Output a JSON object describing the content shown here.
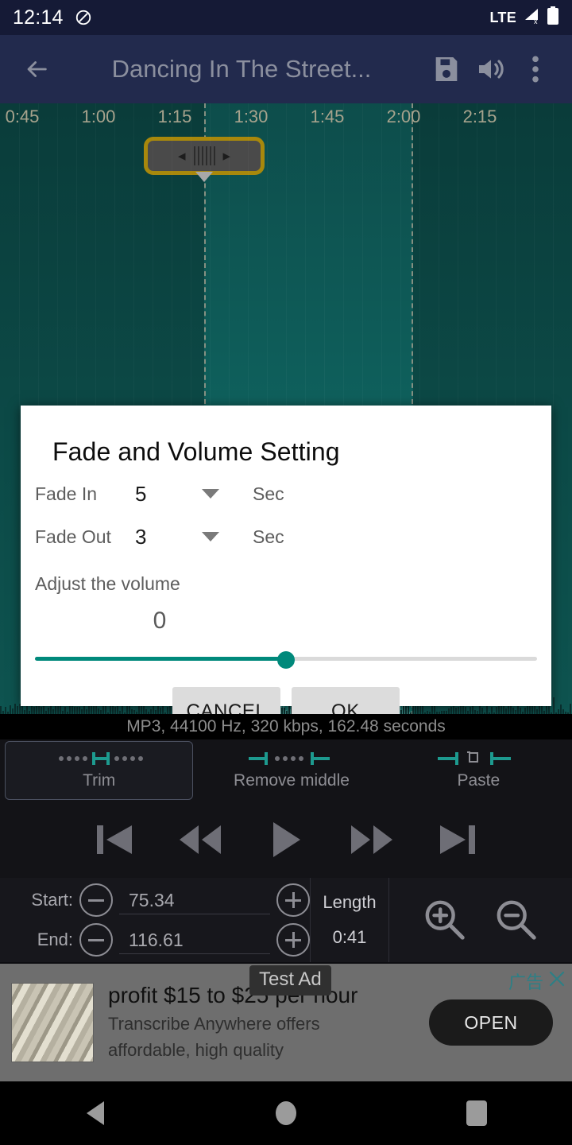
{
  "status_bar": {
    "clock": "12:14",
    "dnd_icon": "do-not-disturb-icon",
    "network_label": "LTE",
    "signal_icon": "signal-no-service-icon",
    "battery_icon": "battery-full-icon"
  },
  "app_bar": {
    "back_icon": "back-arrow-icon",
    "title": "Dancing In The Street...",
    "save_icon": "save-icon",
    "volume_icon": "volume-icon",
    "overflow_icon": "more-vertical-icon"
  },
  "waveform": {
    "ruler_ticks": [
      "0:45",
      "1:00",
      "1:15",
      "1:30",
      "1:45",
      "2:00",
      "2:15"
    ],
    "handle_left_arrow": "◂",
    "handle_right_arrow": "▸",
    "selection_start_label": "1:15",
    "selection_end_label": "2:00",
    "selection_color": "#12706b",
    "background_color": "#0c4a47",
    "handle_border_color": "#a8880c"
  },
  "dialog": {
    "title": "Fade and Volume Setting",
    "fade_in": {
      "label": "Fade In",
      "value": "5",
      "unit": "Sec",
      "caret_icon": "chevron-down-icon"
    },
    "fade_out": {
      "label": "Fade Out",
      "value": "3",
      "unit": "Sec",
      "caret_icon": "chevron-down-icon"
    },
    "volume_section_label": "Adjust the volume",
    "volume_value": "0",
    "volume_percent": 50,
    "accent_color": "#00897b",
    "cancel_label": "CANCEL",
    "ok_label": "OK"
  },
  "file_info": "MP3, 44100 Hz, 320 kbps, 162.48 seconds",
  "edit_modes": [
    {
      "label": "Trim",
      "icon": "trim-icon",
      "selected": true
    },
    {
      "label": "Remove middle",
      "icon": "remove-middle-icon",
      "selected": false
    },
    {
      "label": "Paste",
      "icon": "paste-icon",
      "selected": false
    }
  ],
  "transport": [
    {
      "name": "skip-to-start-icon"
    },
    {
      "name": "rewind-icon"
    },
    {
      "name": "play-icon"
    },
    {
      "name": "fast-forward-icon"
    },
    {
      "name": "skip-to-end-icon"
    }
  ],
  "selection_panel": {
    "start_label": "Start:",
    "start_value": "75.34",
    "end_label": "End:",
    "end_value": "116.61",
    "length_label": "Length",
    "length_value": "0:41",
    "minus_icon": "minus-circle-icon",
    "plus_icon": "plus-circle-icon",
    "zoom_in_icon": "zoom-in-icon",
    "zoom_out_icon": "zoom-out-icon"
  },
  "ad": {
    "badge": "Test Ad",
    "flag_label": "广告",
    "close_icon": "close-icon",
    "headline": "profit $15 to $25 per hour",
    "body_line1": "Transcribe Anywhere offers",
    "body_line2": "affordable, high quality",
    "cta_label": "OPEN",
    "thumbnail_icon": "money-image"
  },
  "nav_bar": {
    "back_icon": "nav-back-icon",
    "home_icon": "nav-home-icon",
    "recents_icon": "nav-recents-icon"
  }
}
